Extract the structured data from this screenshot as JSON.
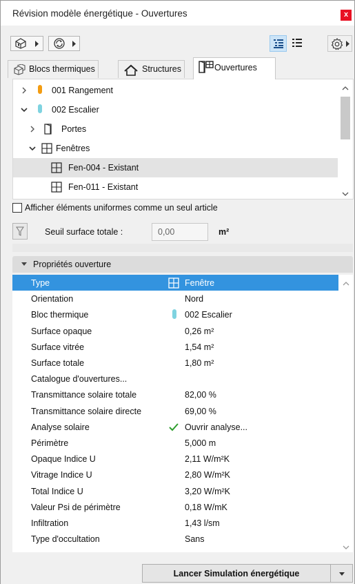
{
  "window": {
    "title": "Révision modèle énergétique - Ouvertures",
    "close_label": "x"
  },
  "tabs": [
    {
      "label": "Blocs thermiques",
      "icon": "blocks-icon"
    },
    {
      "label": "Structures",
      "icon": "house-icon"
    },
    {
      "label": "Ouvertures",
      "icon": "door-window-icon"
    }
  ],
  "tree": [
    {
      "label": "001 Rangement",
      "expanded": false,
      "color": "#f39c12"
    },
    {
      "label": "002 Escalier",
      "expanded": true,
      "color": "#7fd3e0"
    },
    {
      "label": "Portes",
      "expanded": false,
      "icon": "door-icon"
    },
    {
      "label": "Fenêtres",
      "expanded": true,
      "icon": "window-icon"
    },
    {
      "label": "Fen-004 - Existant",
      "selected": true,
      "icon": "window-icon"
    },
    {
      "label": "Fen-011 - Existant",
      "icon": "window-icon"
    }
  ],
  "uniform_checkbox": {
    "label": "Afficher éléments uniformes comme un seul article",
    "checked": false
  },
  "threshold": {
    "label": "Seuil surface totale :",
    "value": "0,00",
    "unit": "m²"
  },
  "properties": {
    "header": "Propriétés ouverture",
    "rows": [
      {
        "key": "Type",
        "value": "Fenêtre"
      },
      {
        "key": "Orientation",
        "value": "Nord"
      },
      {
        "key": "Bloc thermique",
        "value": "002 Escalier"
      },
      {
        "key": "Surface opaque",
        "value": "0,26 m²"
      },
      {
        "key": "Surface vitrée",
        "value": "1,54 m²"
      },
      {
        "key": "Surface totale",
        "value": "1,80 m²"
      },
      {
        "key": "Catalogue d'ouvertures...",
        "value": ""
      },
      {
        "key": "Transmittance solaire totale",
        "value": "82,00 %"
      },
      {
        "key": "Transmittance solaire directe",
        "value": "69,00 %"
      },
      {
        "key": "Analyse solaire",
        "value": "Ouvrir analyse..."
      },
      {
        "key": "Périmètre",
        "value": "5,000 m"
      },
      {
        "key": "Opaque Indice U",
        "value": "2,11 W/m²K"
      },
      {
        "key": "Vitrage Indice U",
        "value": "2,80 W/m²K"
      },
      {
        "key": "Total Indice U",
        "value": "3,20 W/m²K"
      },
      {
        "key": "Valeur Psi de périmètre",
        "value": "0,18 W/mK"
      },
      {
        "key": "Infiltration",
        "value": "1,43 l/sm"
      },
      {
        "key": "Type d'occultation",
        "value": "Sans"
      }
    ]
  },
  "footer": {
    "simulate_label": "Lancer Simulation énergétique"
  },
  "colors": {
    "selection": "#3393df",
    "check": "#2e9e2e",
    "close": "#e81123"
  }
}
